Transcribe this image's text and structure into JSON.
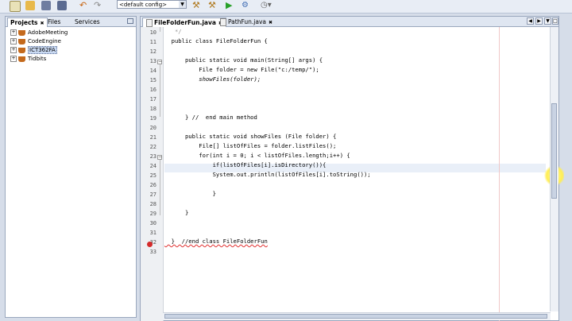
{
  "toolbar": {
    "config_value": "<default config>",
    "icons": [
      "new-file-icon",
      "open-project-icon",
      "save-icon",
      "save-all-icon",
      "undo-icon",
      "redo-icon",
      "build-icon",
      "clean-build-icon",
      "run-icon",
      "debug-icon",
      "profile-icon"
    ]
  },
  "projects_panel": {
    "tabs": [
      {
        "label": "Projects",
        "active": true
      },
      {
        "label": "Files",
        "active": false
      },
      {
        "label": "Services",
        "active": false
      }
    ],
    "tree": [
      {
        "label": "AdobeMeeting",
        "selected": false
      },
      {
        "label": "CodeEngine",
        "selected": false
      },
      {
        "label": "ICT362FA",
        "selected": true
      },
      {
        "label": "Tidbits",
        "selected": false
      }
    ]
  },
  "editor": {
    "tabs": [
      {
        "label": "FileFolderFun.java",
        "active": true
      },
      {
        "label": "PathFun.java",
        "active": false
      }
    ],
    "lines": [
      {
        "n": "10",
        "text": "   */"
      },
      {
        "n": "11",
        "text": "  public class FileFolderFun {"
      },
      {
        "n": "12",
        "text": ""
      },
      {
        "n": "13",
        "text": "      public static void main(String[] args) {"
      },
      {
        "n": "14",
        "text": "          File folder = new File(\"c:/temp/\");"
      },
      {
        "n": "15",
        "text": "          showFiles(folder);"
      },
      {
        "n": "16",
        "text": ""
      },
      {
        "n": "17",
        "text": ""
      },
      {
        "n": "18",
        "text": ""
      },
      {
        "n": "19",
        "text": "      } //  end main method"
      },
      {
        "n": "20",
        "text": ""
      },
      {
        "n": "21",
        "text": "      public static void showFiles (File folder) {"
      },
      {
        "n": "22",
        "text": "          File[] listOfFiles = folder.listFiles();"
      },
      {
        "n": "23",
        "text": "          for(int i = 0; i < listOfFiles.length;i++) {"
      },
      {
        "n": "24",
        "text": "              if(listOfFiles[i].isDirectory()){"
      },
      {
        "n": "25",
        "text": "              System.out.println(listOfFiles[i].toString());"
      },
      {
        "n": "26",
        "text": ""
      },
      {
        "n": "27",
        "text": "              }"
      },
      {
        "n": "28",
        "text": ""
      },
      {
        "n": "29",
        "text": "      }"
      },
      {
        "n": "30",
        "text": ""
      },
      {
        "n": "31",
        "text": ""
      },
      {
        "n": "32",
        "text": "  }  //end class FileFolderFun"
      },
      {
        "n": "33",
        "text": ""
      }
    ]
  },
  "colors": {
    "keyword": "#0000e6",
    "string": "#ce7b00",
    "comment": "#969696",
    "highlight": "#f5f08a",
    "error": "#d42b2b"
  }
}
